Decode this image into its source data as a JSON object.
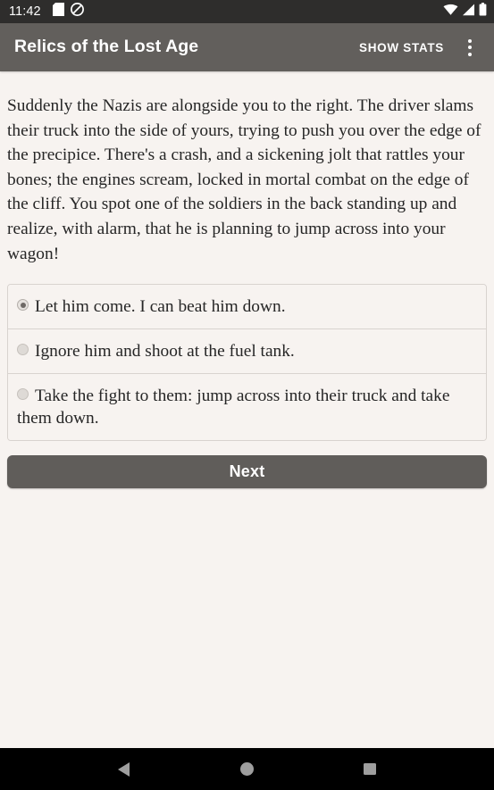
{
  "status_bar": {
    "time": "11:42",
    "left_icons": [
      "sd-card-icon",
      "do-not-disturb-icon"
    ],
    "right_icons": [
      "wifi-icon",
      "cellular-signal-icon",
      "battery-icon"
    ],
    "background_color": "#2E2D2C"
  },
  "app_bar": {
    "title": "Relics of the Lost Age",
    "action_label": "SHOW STATS",
    "overflow_icon": "more-vertical-icon",
    "background_color": "#625F5C"
  },
  "main": {
    "narrative": "Suddenly the Nazis are alongside you to the right. The driver slams their truck into the side of yours, trying to push you over the edge of the precipice. There's a crash, and a sickening jolt that rattles your bones; the engines scream, locked in mortal combat on the edge of the cliff. You spot one of the soldiers in the back standing up and realize, with alarm, that he is planning to jump across into your wagon!",
    "choices": [
      {
        "label": "Let him come. I can beat him down.",
        "selected": true
      },
      {
        "label": "Ignore him and shoot at the fuel tank.",
        "selected": false
      },
      {
        "label": "Take the fight to them: jump across into their truck and take them down.",
        "selected": false
      }
    ],
    "next_label": "Next",
    "background_color": "#F7F3F0",
    "text_color": "#262626",
    "button_color": "#605D5A"
  },
  "nav_bar": {
    "items": [
      "back-icon",
      "home-icon",
      "recents-icon"
    ],
    "background_color": "#000000"
  }
}
